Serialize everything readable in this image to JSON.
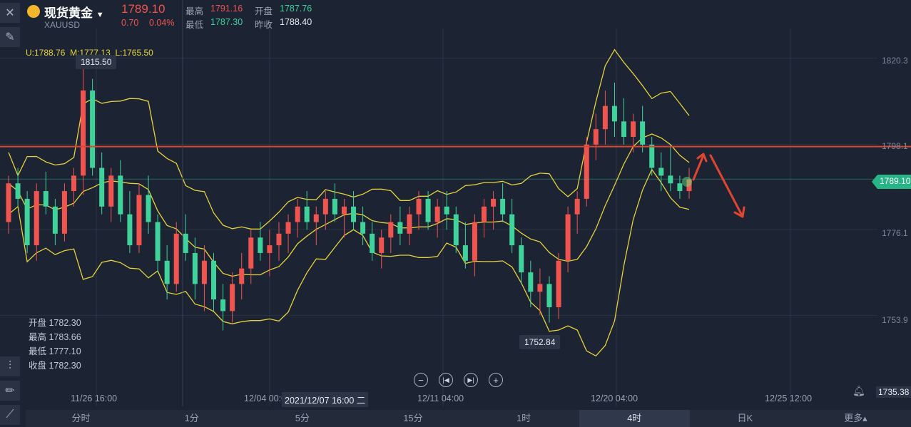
{
  "header": {
    "title": "现货黄金",
    "symbol": "XAUUSD",
    "price": "1789.10",
    "change": "0.70",
    "change_pct": "0.04%",
    "high_label": "最高",
    "high_value": "1791.16",
    "open_label": "开盘",
    "open_value": "1787.76",
    "low_label": "最低",
    "low_value": "1787.30",
    "prevclose_label": "昨收",
    "prevclose_value": "1788.40"
  },
  "indicator": {
    "upper": "U:1788.76",
    "middle": "M:1777.13",
    "lower": "L:1765.50"
  },
  "ohlc_panel": {
    "open": "开盘 1782.30",
    "high": "最高 1783.66",
    "low": "最低 1777.10",
    "close": "收盘 1782.30"
  },
  "tags": {
    "max_label": "1815.50",
    "min_label": "1752.84",
    "current_price": "1789.10",
    "crosshair_time": "2021/12/07 16:00 二",
    "bottom_price": "1735.38"
  },
  "colors": {
    "up": "#f0544f",
    "down": "#3fd39b",
    "band": "#e6d23c",
    "resistance": "#e0452f",
    "background": "#1c2333"
  },
  "timeframes": [
    "分时",
    "1分",
    "5分",
    "15分",
    "1时",
    "4时",
    "日K",
    "更多▴"
  ],
  "active_timeframe": "4时",
  "chart_data": {
    "type": "candlestick",
    "x_tick_labels": [
      "11/26 16:00",
      "12/04 00:00",
      "12/11 04:00",
      "12/20 04:00",
      "12/25 12:00"
    ],
    "y_tick_labels": [
      "1820.3",
      "1798.1",
      "1776.1",
      "1753.9"
    ],
    "ylim": [
      1735,
      1828
    ],
    "indicator": "Bollinger Bands",
    "series": [
      {
        "name": "K",
        "ohlc": [
          [
            1778,
            1790,
            1775,
            1788
          ],
          [
            1788,
            1792,
            1782,
            1784
          ],
          [
            1784,
            1786,
            1770,
            1772
          ],
          [
            1772,
            1788,
            1768,
            1786
          ],
          [
            1786,
            1791,
            1780,
            1782
          ],
          [
            1782,
            1784,
            1772,
            1775
          ],
          [
            1775,
            1788,
            1773,
            1786
          ],
          [
            1786,
            1792,
            1782,
            1790
          ],
          [
            1790,
            1818,
            1785,
            1812
          ],
          [
            1812,
            1815,
            1790,
            1792
          ],
          [
            1792,
            1796,
            1780,
            1782
          ],
          [
            1782,
            1792,
            1778,
            1790
          ],
          [
            1790,
            1794,
            1778,
            1780
          ],
          [
            1780,
            1786,
            1770,
            1772
          ],
          [
            1772,
            1788,
            1770,
            1785
          ],
          [
            1785,
            1790,
            1775,
            1778
          ],
          [
            1778,
            1780,
            1765,
            1768
          ],
          [
            1768,
            1772,
            1758,
            1762
          ],
          [
            1762,
            1778,
            1760,
            1775
          ],
          [
            1775,
            1780,
            1768,
            1770
          ],
          [
            1770,
            1774,
            1758,
            1762
          ],
          [
            1762,
            1772,
            1755,
            1768
          ],
          [
            1768,
            1770,
            1755,
            1758
          ],
          [
            1758,
            1762,
            1750,
            1755
          ],
          [
            1755,
            1765,
            1752,
            1762
          ],
          [
            1762,
            1770,
            1758,
            1766
          ],
          [
            1766,
            1776,
            1762,
            1774
          ],
          [
            1774,
            1778,
            1768,
            1770
          ],
          [
            1770,
            1776,
            1764,
            1772
          ],
          [
            1772,
            1778,
            1768,
            1775
          ],
          [
            1775,
            1780,
            1770,
            1778
          ],
          [
            1778,
            1784,
            1774,
            1782
          ],
          [
            1782,
            1786,
            1776,
            1778
          ],
          [
            1778,
            1782,
            1772,
            1780
          ],
          [
            1780,
            1786,
            1776,
            1784
          ],
          [
            1784,
            1788,
            1778,
            1780
          ],
          [
            1780,
            1784,
            1774,
            1782
          ],
          [
            1782,
            1786,
            1776,
            1778
          ],
          [
            1778,
            1782,
            1772,
            1775
          ],
          [
            1775,
            1778,
            1768,
            1770
          ],
          [
            1770,
            1776,
            1766,
            1774
          ],
          [
            1774,
            1780,
            1770,
            1778
          ],
          [
            1778,
            1782,
            1772,
            1775
          ],
          [
            1775,
            1782,
            1772,
            1780
          ],
          [
            1780,
            1786,
            1776,
            1784
          ],
          [
            1784,
            1786,
            1776,
            1778
          ],
          [
            1778,
            1784,
            1774,
            1782
          ],
          [
            1782,
            1786,
            1776,
            1780
          ],
          [
            1780,
            1782,
            1770,
            1772
          ],
          [
            1772,
            1778,
            1766,
            1768
          ],
          [
            1768,
            1780,
            1764,
            1778
          ],
          [
            1778,
            1784,
            1774,
            1782
          ],
          [
            1782,
            1786,
            1776,
            1784
          ],
          [
            1784,
            1788,
            1778,
            1780
          ],
          [
            1780,
            1784,
            1770,
            1772
          ],
          [
            1772,
            1774,
            1762,
            1765
          ],
          [
            1765,
            1768,
            1756,
            1760
          ],
          [
            1760,
            1766,
            1754,
            1762
          ],
          [
            1762,
            1764,
            1752,
            1756
          ],
          [
            1756,
            1770,
            1753,
            1768
          ],
          [
            1768,
            1782,
            1765,
            1780
          ],
          [
            1780,
            1786,
            1775,
            1784
          ],
          [
            1784,
            1800,
            1782,
            1798
          ],
          [
            1798,
            1806,
            1794,
            1802
          ],
          [
            1802,
            1812,
            1798,
            1808
          ],
          [
            1808,
            1814,
            1800,
            1804
          ],
          [
            1804,
            1810,
            1798,
            1800
          ],
          [
            1800,
            1806,
            1796,
            1804
          ],
          [
            1804,
            1808,
            1796,
            1798
          ],
          [
            1798,
            1800,
            1790,
            1792
          ],
          [
            1792,
            1796,
            1786,
            1790
          ],
          [
            1790,
            1798,
            1786,
            1788
          ],
          [
            1788,
            1790,
            1784,
            1786
          ],
          [
            1786,
            1792,
            1784,
            1789
          ]
        ]
      }
    ]
  }
}
